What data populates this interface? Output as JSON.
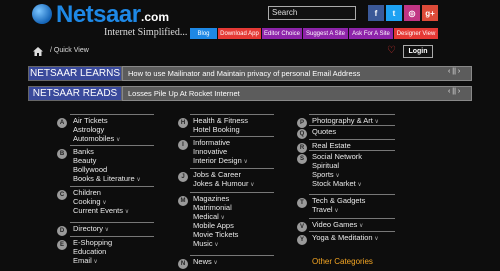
{
  "header": {
    "logo_word": "Netsaar",
    "logo_suffix": ".com",
    "tagline": "Internet Simplified...",
    "search_placeholder": "Search",
    "social": [
      {
        "label": "f",
        "icon": "facebook-icon",
        "color": "#3b5998"
      },
      {
        "label": "t",
        "icon": "twitter-icon",
        "color": "#1da1f2"
      },
      {
        "label": "◎",
        "icon": "instagram-icon",
        "color": "#c13584"
      },
      {
        "label": "g+",
        "icon": "google-plus-icon",
        "color": "#dd4b39"
      }
    ],
    "nav": [
      {
        "label": "Blog",
        "color": "#1e88e5"
      },
      {
        "label": "Download App",
        "color": "#e53935"
      },
      {
        "label": "Editor Choice",
        "color": "#8e24aa"
      },
      {
        "label": "Suggest A Site",
        "color": "#8e24aa"
      },
      {
        "label": "Ask For A Site",
        "color": "#8e24aa"
      },
      {
        "label": "Designer View",
        "color": "#e53935"
      }
    ]
  },
  "breadcrumb": {
    "text": "/ Quick View"
  },
  "login_label": "Login",
  "tickers": [
    {
      "label": "NETSAAR LEARNS",
      "text": "How to use Mailinator and Maintain privacy of personal Email Address",
      "controls": "‹ || ›"
    },
    {
      "label": "NETSAAR READS",
      "text": "Losses Pile Up At Rocket Internet",
      "controls": "‹ || ›"
    }
  ],
  "directory": {
    "A": [
      "Air Tickets",
      "Astrology",
      "Automobiles"
    ],
    "B": [
      "Banks",
      "Beauty",
      "Bollywood",
      "Books & Literature"
    ],
    "C": [
      "Children",
      "Cooking",
      "Current Events"
    ],
    "D": [
      "Directory"
    ],
    "E": [
      "E-Shopping",
      "Education",
      "Email"
    ],
    "H": [
      "Health & Fitness",
      "Hotel Booking"
    ],
    "I": [
      "Informative",
      "Innovative",
      "Interior Design"
    ],
    "J": [
      "Jobs & Career",
      "Jokes & Humour"
    ],
    "M": [
      "Magazines",
      "Matrimonial",
      "Medical",
      "Mobile Apps",
      "Movie Tickets",
      "Music"
    ],
    "N": [
      "News"
    ],
    "P": [
      "Photography & Art"
    ],
    "Q": [
      "Quotes"
    ],
    "R": [
      "Real Estate"
    ],
    "S": [
      "Social Network",
      "Spiritual",
      "Sports",
      "Stock Market"
    ],
    "T": [
      "Tech & Gadgets",
      "Travel"
    ],
    "V": [
      "Video Games"
    ],
    "Y": [
      "Yoga & Meditation"
    ]
  },
  "other_categories": "Other Categories"
}
